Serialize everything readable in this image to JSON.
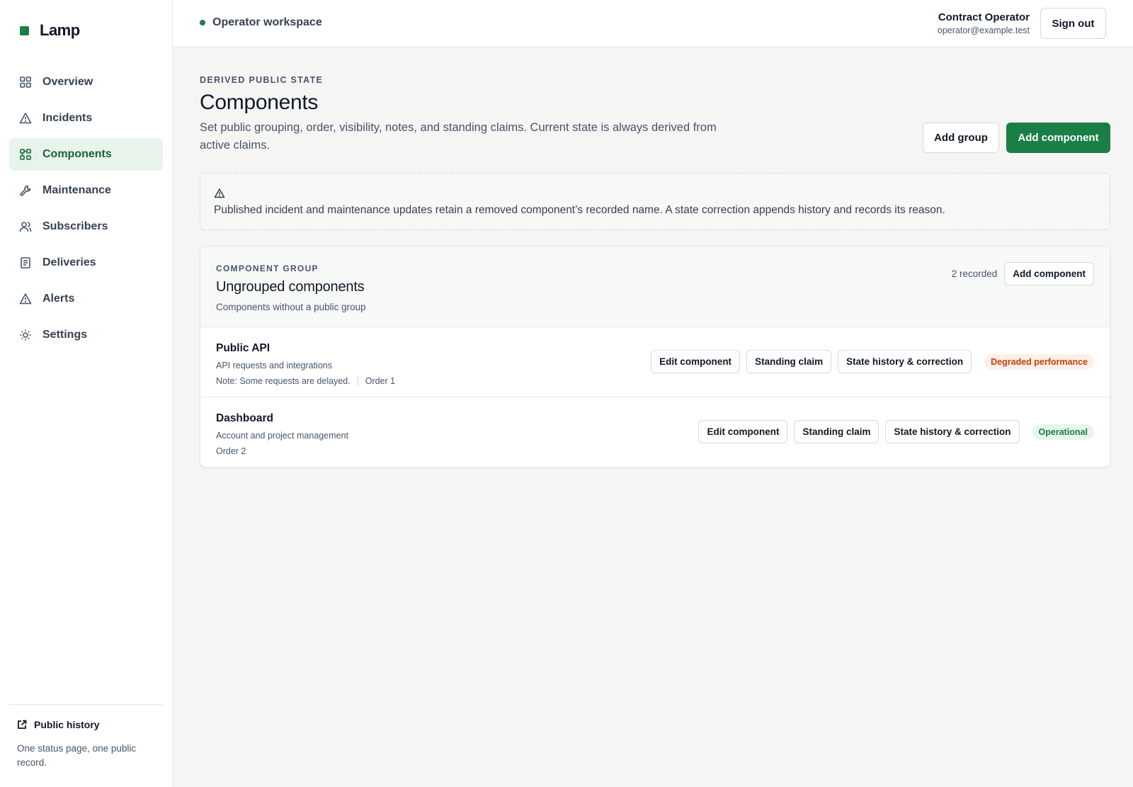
{
  "brand": {
    "name": "Lamp",
    "accent": "#1a7f47"
  },
  "sidebar": {
    "items": [
      {
        "label": "Overview",
        "icon": "grid-icon"
      },
      {
        "label": "Incidents",
        "icon": "warning-icon"
      },
      {
        "label": "Components",
        "icon": "components-icon",
        "active": true
      },
      {
        "label": "Maintenance",
        "icon": "wrench-icon"
      },
      {
        "label": "Subscribers",
        "icon": "users-icon"
      },
      {
        "label": "Deliveries",
        "icon": "document-icon"
      },
      {
        "label": "Alerts",
        "icon": "warning-icon"
      },
      {
        "label": "Settings",
        "icon": "sun-gear-icon"
      }
    ],
    "footer": {
      "link_label": "Public history",
      "description": "One status page, one public record."
    }
  },
  "topbar": {
    "workspace": "Operator workspace",
    "user_name": "Contract Operator",
    "user_email": "operator@example.test",
    "signout_label": "Sign out"
  },
  "page": {
    "eyebrow": "DERIVED PUBLIC STATE",
    "title": "Components",
    "description": "Set public grouping, order, visibility, notes, and standing claims. Current state is always derived from active claims.",
    "add_group_label": "Add group",
    "add_component_label": "Add component"
  },
  "notice": {
    "text": "Published incident and maintenance updates retain a removed component’s recorded name. A state correction appends history and records its reason."
  },
  "group": {
    "eyebrow": "COMPONENT GROUP",
    "title": "Ungrouped components",
    "description": "Components without a public group",
    "recorded": "2 recorded",
    "add_component_label": "Add component",
    "components": [
      {
        "name": "Public API",
        "description": "API requests and integrations",
        "note": "Note: Some requests are delayed.",
        "order": "Order 1",
        "edit_label": "Edit component",
        "claim_label": "Standing claim",
        "history_label": "State history & correction",
        "status": "Degraded performance",
        "status_color": "#c2410c"
      },
      {
        "name": "Dashboard",
        "description": "Account and project management",
        "order": "Order 2",
        "edit_label": "Edit component",
        "claim_label": "Standing claim",
        "history_label": "State history & correction",
        "status": "Operational",
        "status_color": "#15803d"
      }
    ]
  }
}
